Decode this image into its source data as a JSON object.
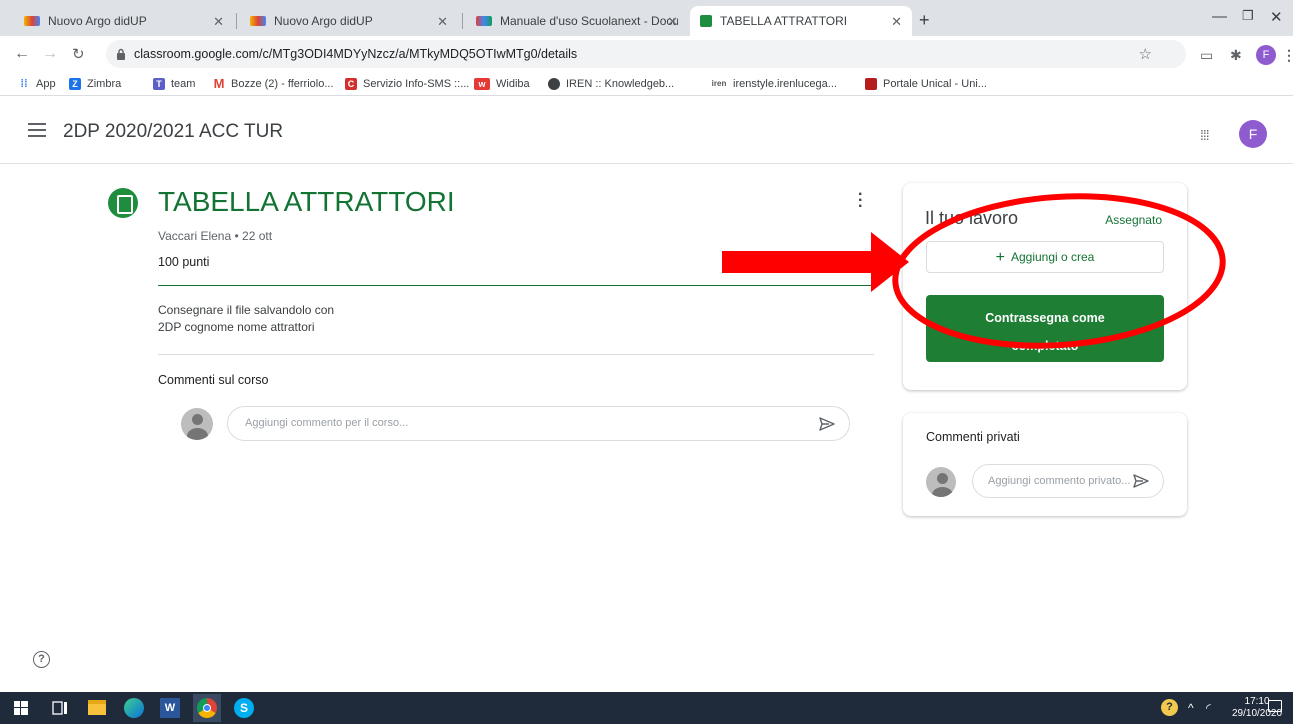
{
  "browser": {
    "tabs": [
      {
        "label": "Nuovo Argo didUP",
        "active": false
      },
      {
        "label": "Nuovo Argo didUP",
        "active": false
      },
      {
        "label": "Manuale d'uso Scuolanext - Docu",
        "active": false
      },
      {
        "label": "TABELLA ATTRATTORI",
        "active": true
      }
    ],
    "new_tab_symbol": "+",
    "url": "classroom.google.com/c/MTg3ODI4MDYyNzcz/a/MTkyMDQ5OTIwMTg0/details",
    "profile_initial": "F",
    "bookmarks": [
      "App",
      "Zimbra",
      "team",
      "Bozze (2) - fferriolo...",
      "Servizio Info-SMS ::...",
      "Widiba",
      "IREN :: Knowledgeb...",
      "irenstyle.irenlucega...",
      "Portale Unical - Uni..."
    ]
  },
  "header": {
    "class_name": "2DP 2020/2021 ACC TUR",
    "avatar_initial": "F"
  },
  "assignment": {
    "title": "TABELLA ATTRATTORI",
    "author_date": "Vaccari Elena • 22 ott",
    "points": "100 punti",
    "description_line1": "Consegnare il file salvandolo con",
    "description_line2": "2DP  cognome nome attrattori",
    "class_comments_title": "Commenti sul corso",
    "class_comment_placeholder": "Aggiungi commento per il corso..."
  },
  "work_card": {
    "title": "Il tuo lavoro",
    "status": "Assegnato",
    "add_label": "Aggiungi o crea",
    "done_line1": "Contrassegna come",
    "done_line2": "completato"
  },
  "private_card": {
    "title": "Commenti privati",
    "placeholder": "Aggiungi commento privato..."
  },
  "taskbar": {
    "time": "17:10",
    "date": "29/10/2020"
  },
  "colors": {
    "classroom_green": "#137333",
    "done_button": "#1e7e34",
    "annotation_red": "#ff0000",
    "avatar_purple": "#8e5ccf"
  }
}
